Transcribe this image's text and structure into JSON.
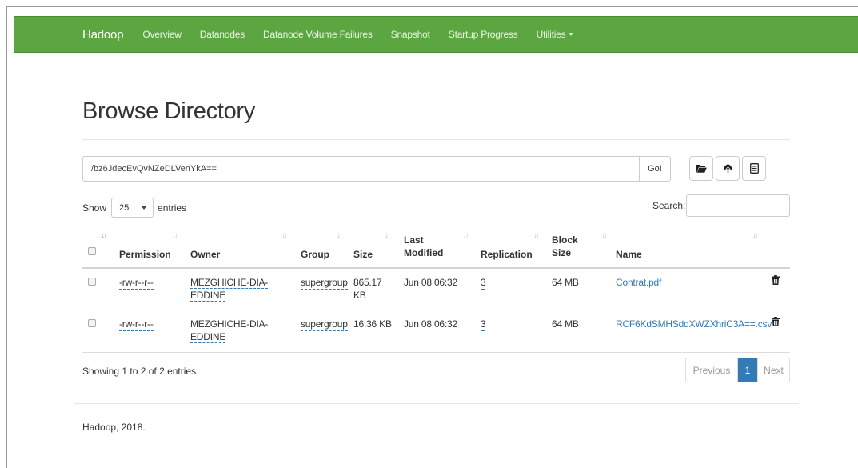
{
  "nav": {
    "brand": "Hadoop",
    "links": [
      "Overview",
      "Datanodes",
      "Datanode Volume Failures",
      "Snapshot",
      "Startup Progress",
      "Utilities"
    ]
  },
  "page": {
    "title": "Browse Directory"
  },
  "path": {
    "value": "/bz6JdecEvQvNZeDLVenYkA==",
    "go_label": "Go!"
  },
  "toolbar": {
    "icons": [
      "folder-open-icon",
      "cloud-upload-icon",
      "list-alt-icon"
    ]
  },
  "table_controls": {
    "show_label": "Show",
    "page_size": "25",
    "entries_label": "entries",
    "search_label": "Search:"
  },
  "table": {
    "headers": [
      "Permission",
      "Owner",
      "Group",
      "Size",
      "Last Modified",
      "Replication",
      "Block Size",
      "Name"
    ],
    "rows": [
      {
        "permission": "-rw-r--r--",
        "owner": "MEZGHICHE-DIA-EDDINE",
        "group": "supergroup",
        "size": "865.17 KB",
        "modified": "Jun 08 06:32",
        "replication": "3",
        "block_size": "64 MB",
        "name": "Contrat.pdf"
      },
      {
        "permission": "-rw-r--r--",
        "owner": "MEZGHICHE-DIA-EDDINE",
        "group": "supergroup",
        "size": "16.36 KB",
        "modified": "Jun 08 06:32",
        "replication": "3",
        "block_size": "64 MB",
        "name": "RCF6KdSMHSdqXWZXhriC3A==.csv"
      }
    ]
  },
  "pagination": {
    "info": "Showing 1 to 2 of 2 entries",
    "previous": "Previous",
    "current": "1",
    "next": "Next"
  },
  "footer": {
    "text": "Hadoop, 2018."
  },
  "colors": {
    "navbar": "#5ca641",
    "link": "#337ab7",
    "active_page": "#337ab7"
  }
}
